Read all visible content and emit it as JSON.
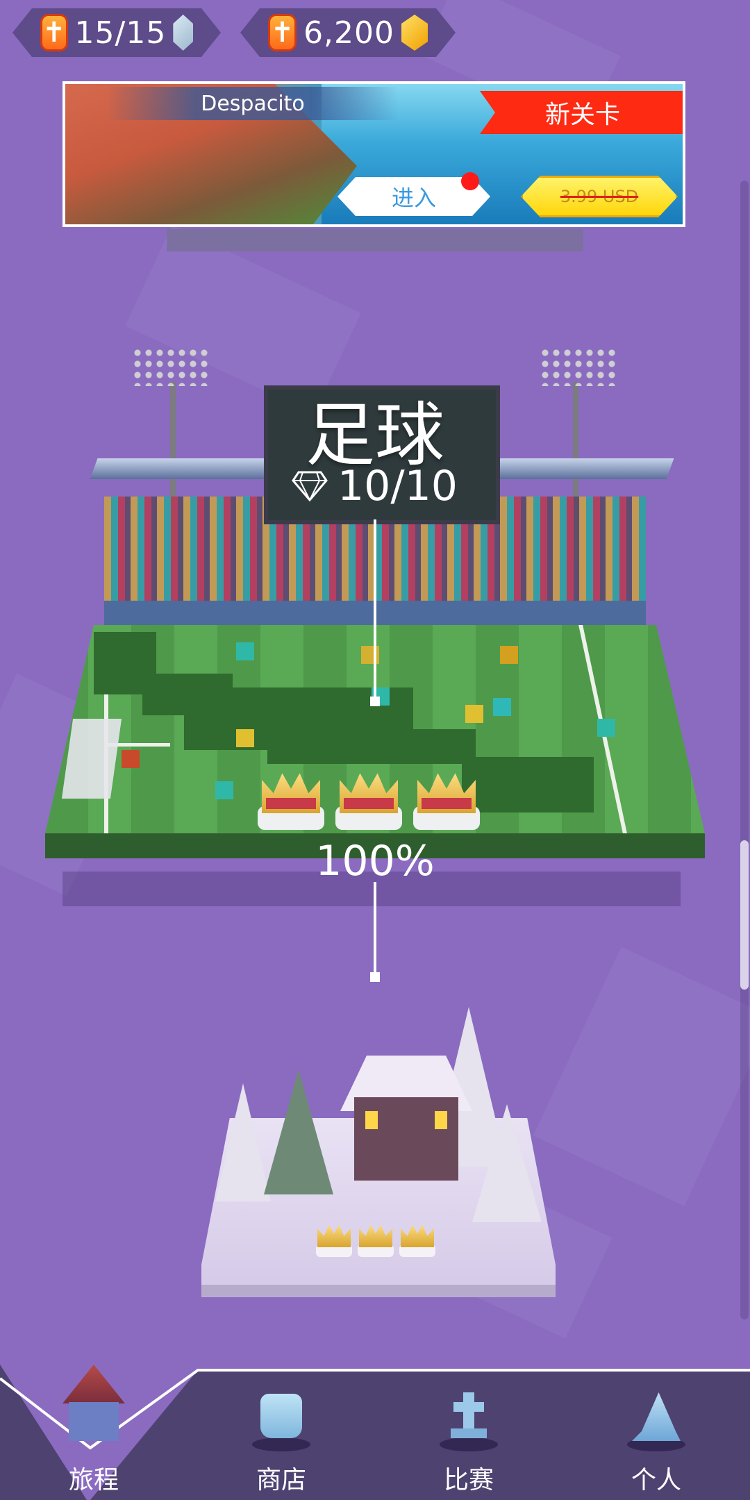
{
  "currency": {
    "lives": {
      "value": "15/15",
      "icon": "ice-cube-icon",
      "add_icon": "plus-icon"
    },
    "coins": {
      "value": "6,200",
      "icon": "gold-cube-icon",
      "add_icon": "plus-icon"
    }
  },
  "banner": {
    "title": "Despacito",
    "ribbon": "新关卡",
    "enter_label": "进入",
    "price": "3.99 USD",
    "notification": true
  },
  "level": {
    "name": "足球",
    "gems": "10/10",
    "progress": "100%",
    "progress_value": 100,
    "crowns_earned": 3,
    "gem_icon": "diamond-icon"
  },
  "next_level": {
    "theme": "winter",
    "crowns": 3
  },
  "bottom_nav": {
    "active": "journey",
    "items": [
      {
        "id": "journey",
        "label": "旅程",
        "icon": "house-icon"
      },
      {
        "id": "shop",
        "label": "商店",
        "icon": "skull-icon"
      },
      {
        "id": "match",
        "label": "比赛",
        "icon": "gravestone-icon"
      },
      {
        "id": "profile",
        "label": "个人",
        "icon": "wizard-hat-icon"
      }
    ]
  },
  "colors": {
    "background": "#8a6bc0",
    "nav": "#4e4270",
    "ribbon": "#ff2a12",
    "price_button": "#ffd60a",
    "enter_text": "#3a9adf"
  }
}
